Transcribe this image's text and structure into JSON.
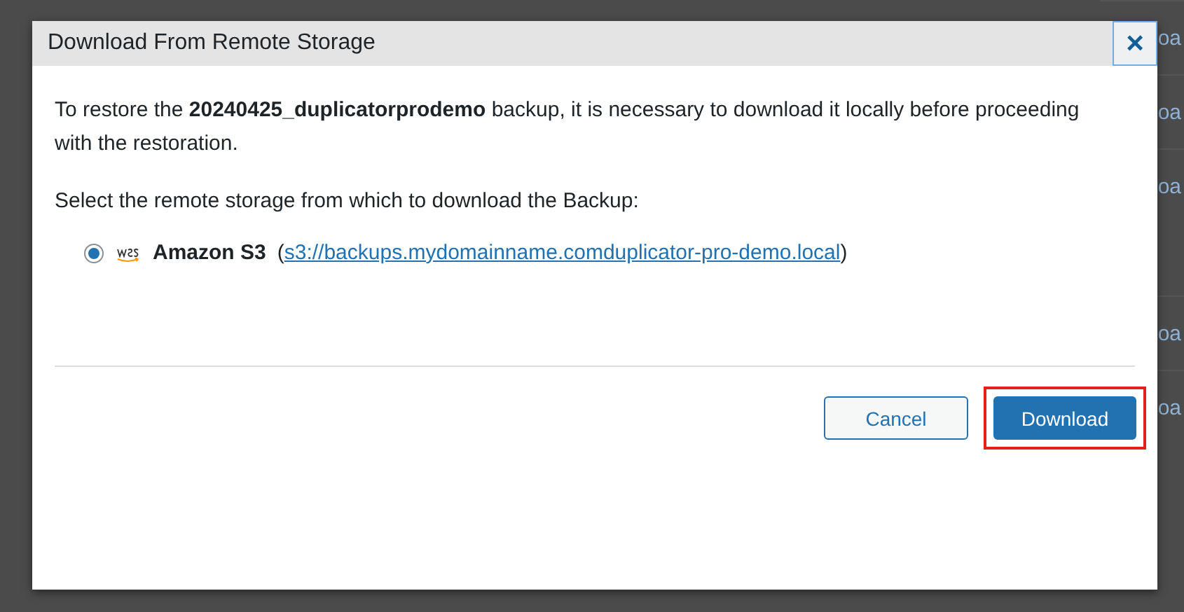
{
  "backdrop": {
    "row_links": [
      "oa",
      "oa",
      "oa",
      "oa",
      "oa"
    ]
  },
  "dialog": {
    "title": "Download From Remote Storage",
    "close_label": "×",
    "intro": "To restore the **20240425_duplicatorprodemo** backup, it is necessary to download it locally before proceeding with the restoration.",
    "prompt": "Select the remote storage from which to download the Backup:",
    "storages": [
      {
        "name": "Amazon S3",
        "open_paren": "(",
        "url": "s3://backups.mydomainname.comduplicator-pro-demo.local",
        "close_paren": ")",
        "selected": true
      }
    ],
    "buttons": [
      {
        "kind": "secondary",
        "label": "Cancel",
        "highlighted": false
      },
      {
        "kind": "primary",
        "label": "Download",
        "highlighted": true
      }
    ]
  }
}
